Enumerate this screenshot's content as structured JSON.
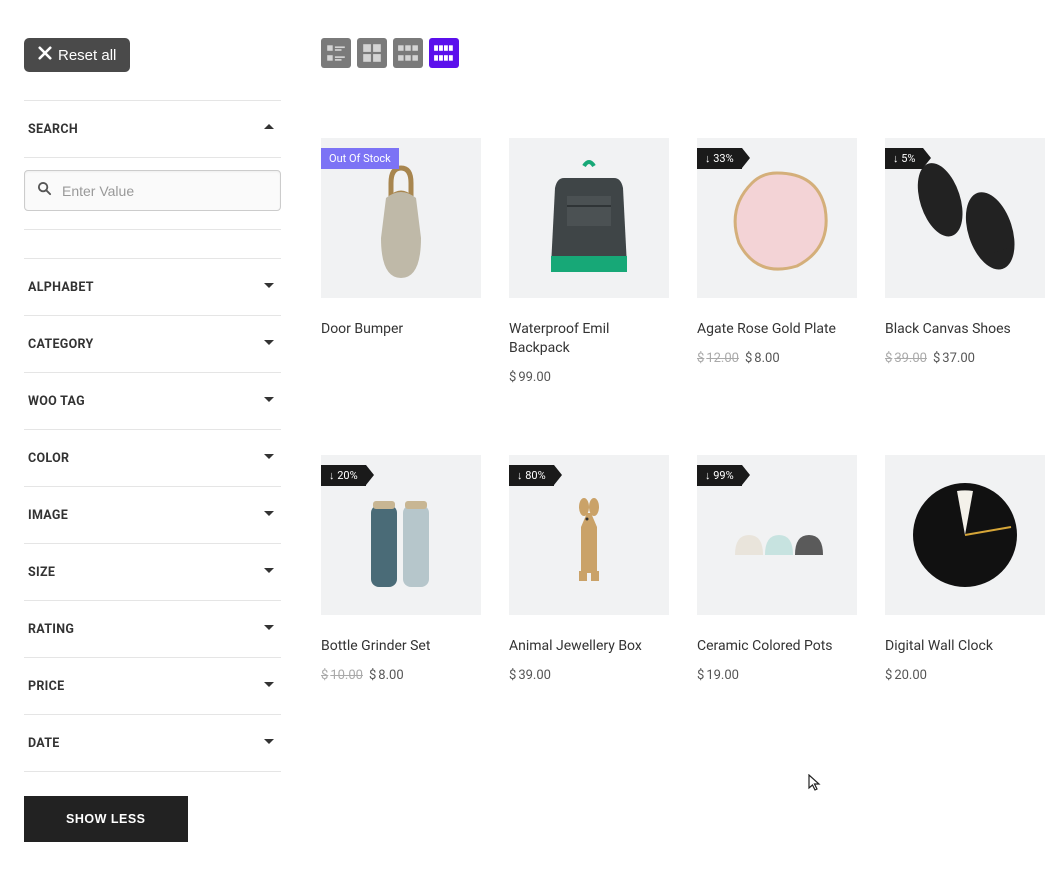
{
  "sidebar": {
    "reset_label": "Reset all",
    "show_less_label": "SHOW LESS",
    "search": {
      "label": "SEARCH",
      "placeholder": "Enter Value",
      "expanded": true
    },
    "filters": [
      {
        "label": "ALPHABET",
        "expanded": false
      },
      {
        "label": "CATEGORY",
        "expanded": false
      },
      {
        "label": "WOO TAG",
        "expanded": false
      },
      {
        "label": "COLOR",
        "expanded": false
      },
      {
        "label": "IMAGE",
        "expanded": false
      },
      {
        "label": "SIZE",
        "expanded": false
      },
      {
        "label": "RATING",
        "expanded": false
      },
      {
        "label": "PRICE",
        "expanded": false
      },
      {
        "label": "DATE",
        "expanded": false
      }
    ]
  },
  "view_modes": [
    "list",
    "grid2",
    "grid3",
    "grid4"
  ],
  "active_view": "grid4",
  "currency": "$",
  "products": [
    {
      "title": "Door Bumper",
      "badge_type": "oos",
      "badge_text": "Out Of Stock",
      "price_old": null,
      "price": null
    },
    {
      "title": "Waterproof Emil Backpack",
      "badge_type": null,
      "badge_text": null,
      "price_old": null,
      "price": "99.00"
    },
    {
      "title": "Agate Rose Gold Plate",
      "badge_type": "discount",
      "badge_text": "↓ 33%",
      "price_old": "12.00",
      "price": "8.00"
    },
    {
      "title": "Black Canvas Shoes",
      "badge_type": "discount",
      "badge_text": "↓ 5%",
      "price_old": "39.00",
      "price": "37.00"
    },
    {
      "title": "Bottle Grinder Set",
      "badge_type": "discount",
      "badge_text": "↓ 20%",
      "price_old": "10.00",
      "price": "8.00"
    },
    {
      "title": "Animal Jewellery Box",
      "badge_type": "discount",
      "badge_text": "↓ 80%",
      "price_old": null,
      "price": "39.00"
    },
    {
      "title": "Ceramic Colored Pots",
      "badge_type": "discount",
      "badge_text": "↓ 99%",
      "price_old": null,
      "price": "19.00"
    },
    {
      "title": "Digital Wall Clock",
      "badge_type": null,
      "badge_text": null,
      "price_old": null,
      "price": "20.00"
    }
  ]
}
